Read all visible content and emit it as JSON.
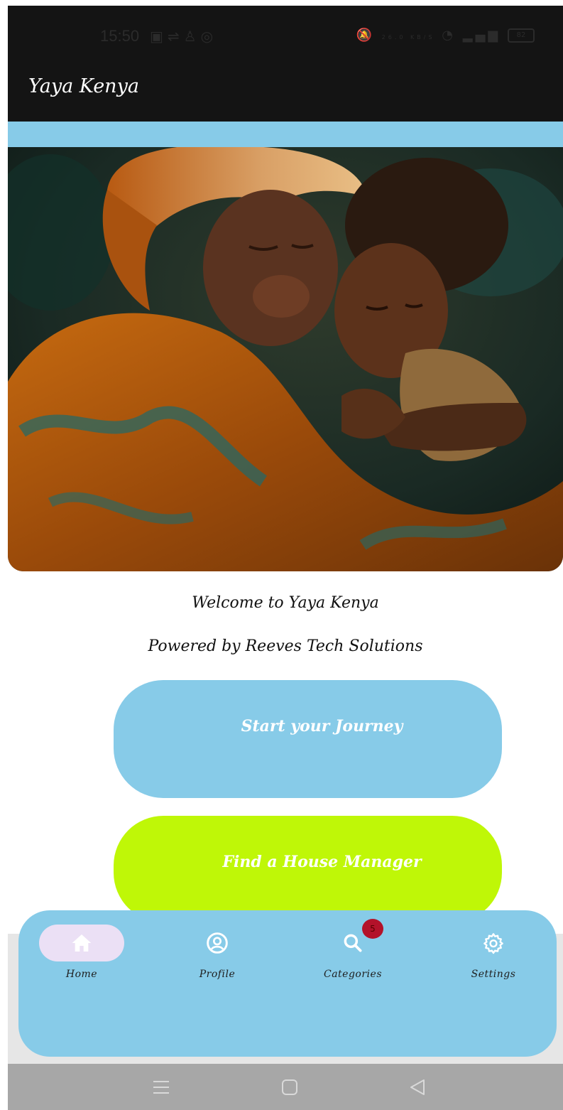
{
  "status_bar": {
    "time": "15:50",
    "left_icons": [
      "linkedin-icon",
      "sync-icon",
      "profile-icon",
      "instagram-icon"
    ],
    "right_icons": [
      "mute-icon",
      "data-speed-icon",
      "wifi-icon",
      "signal-icon"
    ],
    "data_speed": "26.0 KB/S",
    "battery": "82"
  },
  "app_bar": {
    "title": "Yaya Kenya"
  },
  "hero": {
    "image": "mother-and-child-painting"
  },
  "welcome": {
    "title": "Welcome to Yaya Kenya",
    "subtitle": "Powered by Reeves Tech Solutions"
  },
  "actions": {
    "start_journey": "Start your Journey",
    "find_house_manager": "Find a House Manager"
  },
  "bottom_nav": {
    "items": [
      {
        "label": "Home",
        "icon": "home-icon",
        "active": true
      },
      {
        "label": "Profile",
        "icon": "profile-icon",
        "active": false
      },
      {
        "label": "Categories",
        "icon": "search-icon",
        "active": false,
        "badge": "5"
      },
      {
        "label": "Settings",
        "icon": "gear-icon",
        "active": false
      }
    ]
  },
  "colors": {
    "app_bar": "#141414",
    "accent_blue": "#87cbe8",
    "accent_lime": "#bff707",
    "active_pill": "#ebe0f5",
    "badge": "#b3122a"
  },
  "system_nav": [
    "menu-icon",
    "home-square-icon",
    "back-icon"
  ]
}
